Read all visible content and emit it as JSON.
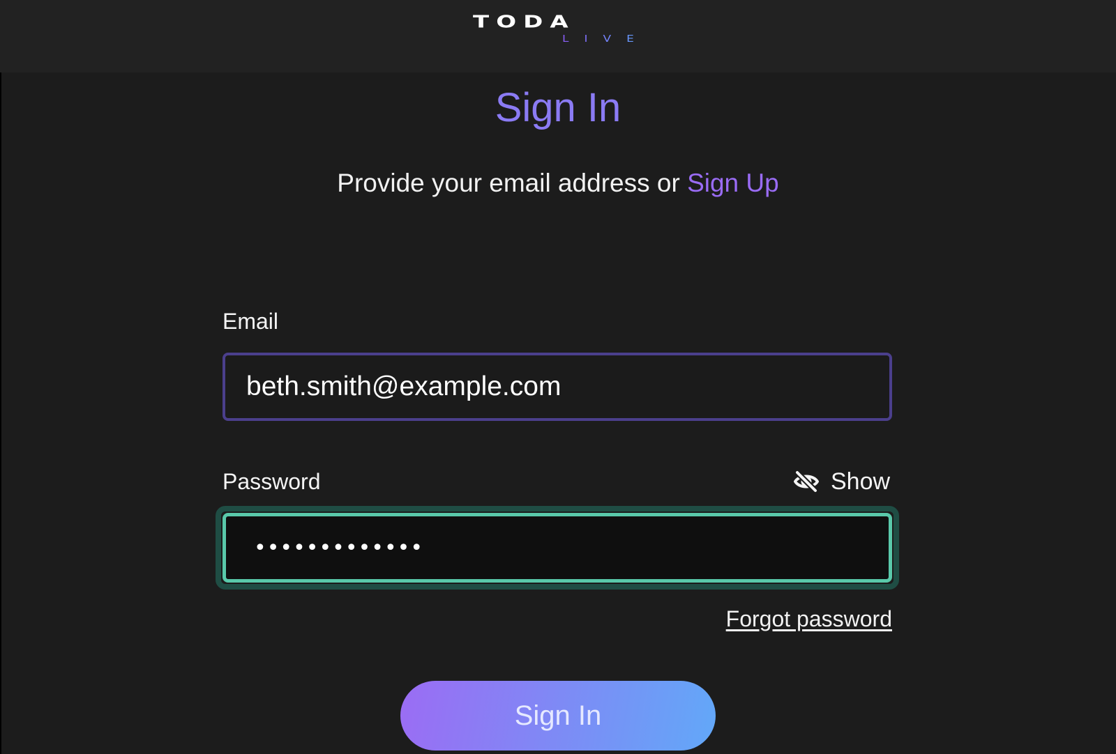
{
  "header": {
    "logo_main": "TODA",
    "logo_sub": "LIVE"
  },
  "page": {
    "title": "Sign In",
    "subtitle_prefix": "Provide your email address or",
    "signup_link": "Sign Up"
  },
  "form": {
    "email_label": "Email",
    "email_value": "beth.smith@example.com",
    "password_label": "Password",
    "password_value": "•••••••••••••",
    "show_label": "Show",
    "show_icon": "eye-slash-icon",
    "forgot_link": "Forgot password",
    "submit_label": "Sign In"
  },
  "colors": {
    "background": "#1c1c1c",
    "header_background": "#222222",
    "title_purple": "#8b7bf4",
    "link_purple": "#9a6cf5",
    "email_border": "#4b3f8c",
    "password_focus_border": "#59c9aa",
    "button_gradient_start": "#9b6cf4",
    "button_gradient_end": "#62a8f8"
  }
}
